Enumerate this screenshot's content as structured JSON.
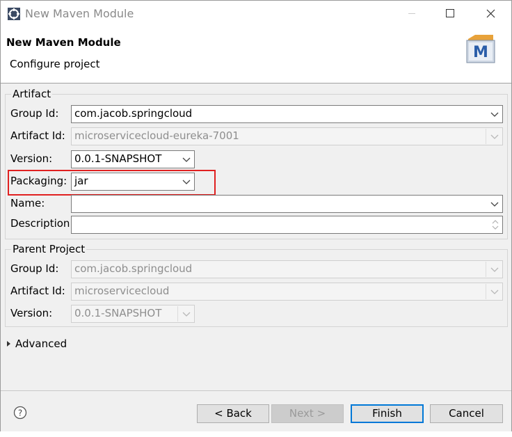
{
  "window": {
    "title": "New Maven Module"
  },
  "header": {
    "title": "New Maven Module",
    "subtitle": "Configure project"
  },
  "artifact": {
    "legend": "Artifact",
    "group_id_label": "Group Id:",
    "group_id_value": "com.jacob.springcloud",
    "artifact_id_label": "Artifact Id:",
    "artifact_id_value": "microservicecloud-eureka-7001",
    "version_label": "Version:",
    "version_value": "0.0.1-SNAPSHOT",
    "packaging_label": "Packaging:",
    "packaging_value": "jar",
    "name_label": "Name:",
    "name_value": "",
    "description_label": "Description:",
    "description_value": ""
  },
  "parent": {
    "legend": "Parent Project",
    "group_id_label": "Group Id:",
    "group_id_value": "com.jacob.springcloud",
    "artifact_id_label": "Artifact Id:",
    "artifact_id_value": "microservicecloud",
    "version_label": "Version:",
    "version_value": "0.0.1-SNAPSHOT"
  },
  "advanced": {
    "label": "Advanced"
  },
  "buttons": {
    "back": "< Back",
    "next": "Next >",
    "finish": "Finish",
    "cancel": "Cancel"
  },
  "colors": {
    "accent": "#0078d7",
    "highlight": "#e02020",
    "disabled_text": "#8e8e8e"
  }
}
